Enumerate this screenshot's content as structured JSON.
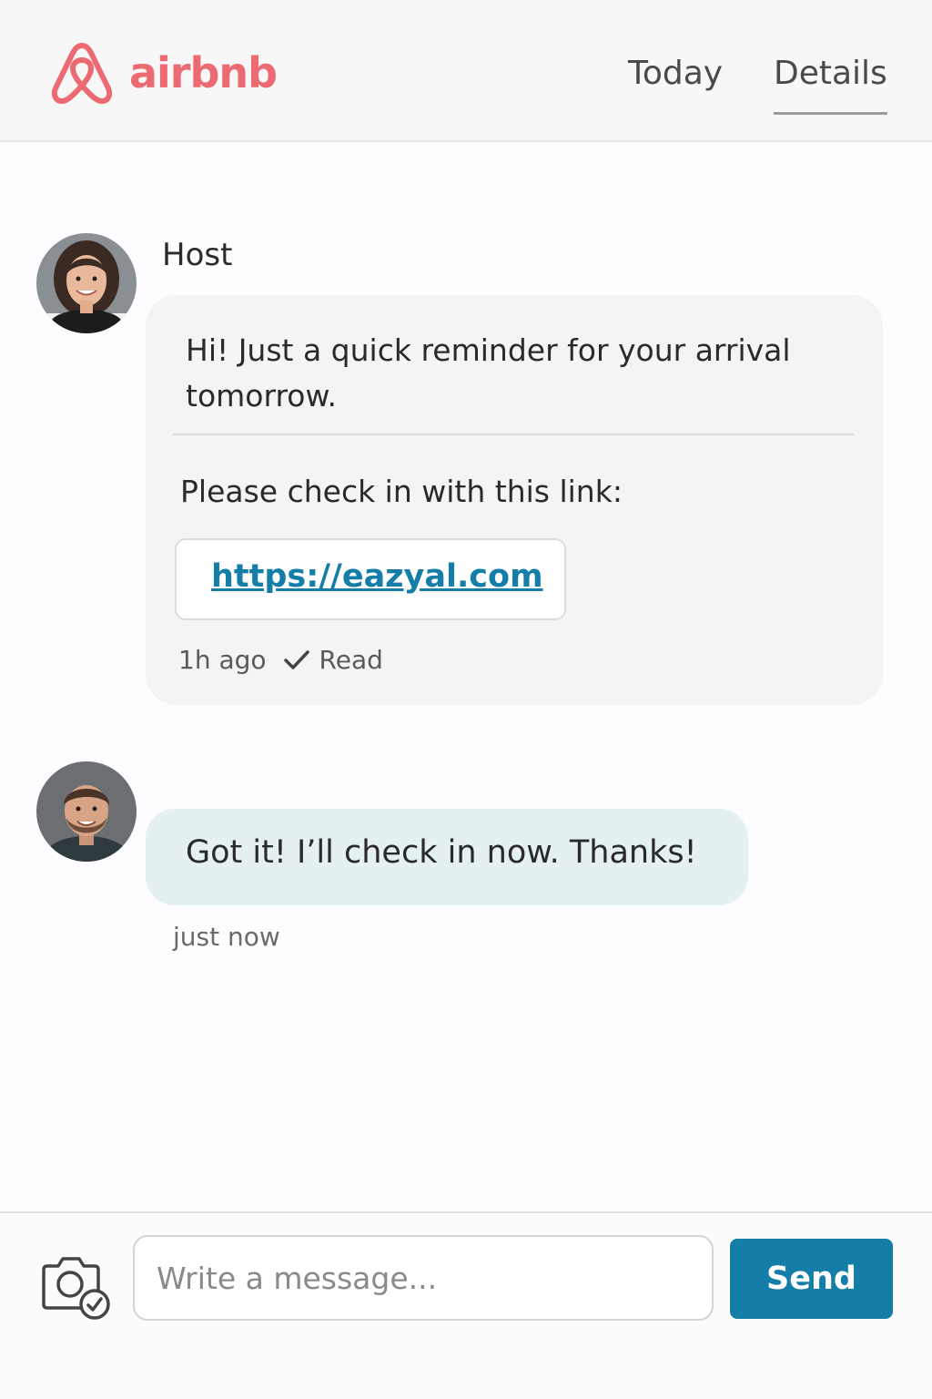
{
  "header": {
    "brand": "airbnb",
    "tabs": [
      {
        "label": "Today",
        "active": false
      },
      {
        "label": "Details",
        "active": true
      }
    ]
  },
  "conversation": {
    "host": {
      "name": "Host",
      "message_line1": "Hi! Just a quick reminder for your arrival tomorrow.",
      "message_line2": "Please check in with this link:",
      "link": "https://eazyal.com",
      "time": "1h ago",
      "status": "Read"
    },
    "guest": {
      "message": "Got it! I’ll check in now. Thanks!",
      "time": "just now"
    }
  },
  "composer": {
    "placeholder": "Write a message...",
    "send_label": "Send"
  },
  "colors": {
    "brand": "#ec6a71",
    "accent": "#147ea8",
    "host_bubble": "#f4f4f6",
    "guest_bubble": "#e5f0f3"
  },
  "icons": [
    "airbnb-logo-icon",
    "checkmark-icon",
    "camera-icon"
  ]
}
